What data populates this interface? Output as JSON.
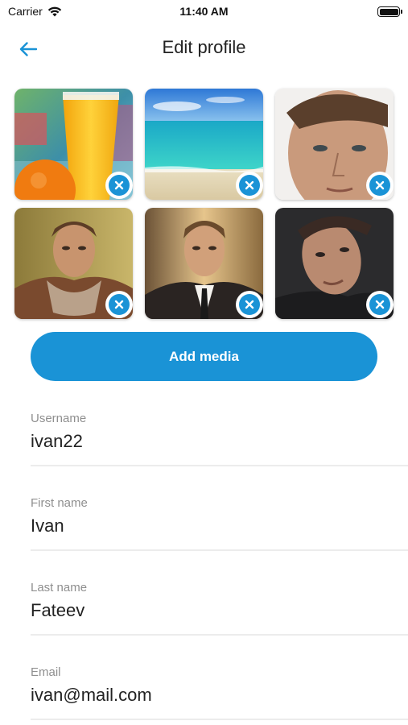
{
  "status_bar": {
    "carrier": "Carrier",
    "time": "11:40 AM"
  },
  "header": {
    "title": "Edit profile",
    "back_icon": "arrow-left-icon"
  },
  "media": [
    {
      "name": "orange-juice-photo",
      "remove_icon": "close-icon"
    },
    {
      "name": "beach-photo",
      "remove_icon": "close-icon"
    },
    {
      "name": "man-portrait-1-photo",
      "remove_icon": "close-icon"
    },
    {
      "name": "man-portrait-2-photo",
      "remove_icon": "close-icon"
    },
    {
      "name": "man-portrait-3-photo",
      "remove_icon": "close-icon"
    },
    {
      "name": "man-portrait-4-photo",
      "remove_icon": "close-icon"
    }
  ],
  "add_media_label": "Add media",
  "fields": {
    "username": {
      "label": "Username",
      "value": "ivan22"
    },
    "first_name": {
      "label": "First name",
      "value": "Ivan"
    },
    "last_name": {
      "label": "Last name",
      "value": "Fateev"
    },
    "email": {
      "label": "Email",
      "value": "ivan@mail.com"
    }
  },
  "colors": {
    "accent": "#1a93d6",
    "label": "#8f8f8f",
    "divider": "#ececec"
  }
}
